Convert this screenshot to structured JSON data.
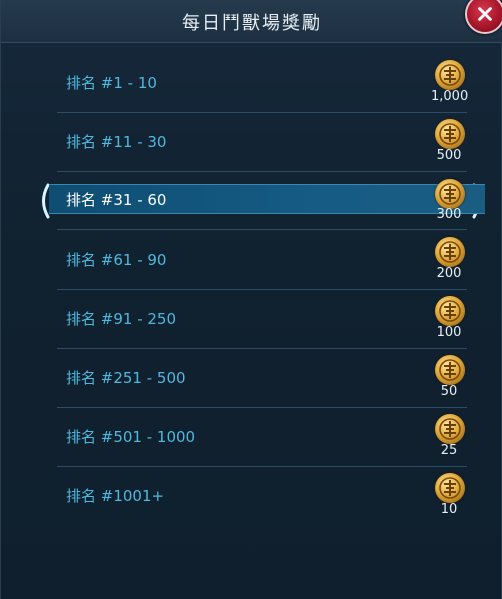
{
  "window": {
    "title": "每日鬥獸場獎勵"
  },
  "rewards": [
    {
      "rank": "排名 #1 - 10",
      "amount": "1,000"
    },
    {
      "rank": "排名 #11 - 30",
      "amount": "500"
    },
    {
      "rank": "排名 #31 - 60",
      "amount": "300"
    },
    {
      "rank": "排名 #61 - 90",
      "amount": "200"
    },
    {
      "rank": "排名 #91 - 250",
      "amount": "100"
    },
    {
      "rank": "排名 #251 - 500",
      "amount": "50"
    },
    {
      "rank": "排名 #501 - 1000",
      "amount": "25"
    },
    {
      "rank": "排名 #1001+",
      "amount": "10"
    }
  ],
  "selected_index": 2,
  "icons": {
    "close": "close-icon",
    "currency": "arena-coin-icon"
  },
  "colors": {
    "rank_text": "#4fb8df",
    "selected_row": "#155b84",
    "close_button": "#a8162b",
    "coin": "#e0a93a"
  }
}
